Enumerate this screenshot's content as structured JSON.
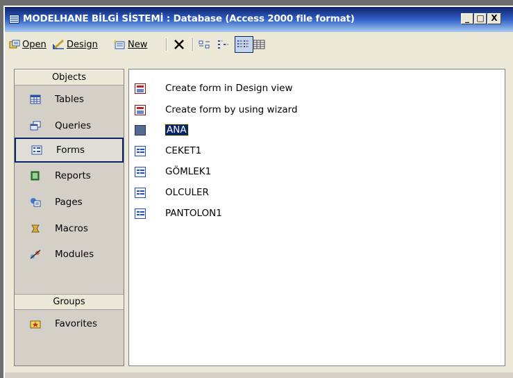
{
  "window": {
    "title": "MODELHANE BİLGİ SİSTEMİ : Database (Access 2000 file format)",
    "buttons": {
      "minimize": "_",
      "maximize": "□",
      "close": "X"
    }
  },
  "toolbar": {
    "open_label": "Open",
    "design_label": "Design",
    "new_label": "New",
    "delete_icon": "delete-icon"
  },
  "sidebar": {
    "objects_header": "Objects",
    "groups_header": "Groups",
    "items": [
      {
        "label": "Tables",
        "icon": "table-icon"
      },
      {
        "label": "Queries",
        "icon": "query-icon"
      },
      {
        "label": "Forms",
        "icon": "form-icon",
        "selected": true
      },
      {
        "label": "Reports",
        "icon": "report-icon"
      },
      {
        "label": "Pages",
        "icon": "page-icon"
      },
      {
        "label": "Macros",
        "icon": "macro-icon"
      },
      {
        "label": "Modules",
        "icon": "module-icon"
      }
    ],
    "groups": [
      {
        "label": "Favorites",
        "icon": "favorites-icon"
      }
    ]
  },
  "objects_list": {
    "items": [
      {
        "label": "Create form in Design view",
        "icon": "design-wizard-icon"
      },
      {
        "label": "Create form by using wizard",
        "icon": "form-wizard-icon"
      },
      {
        "label": "ANA",
        "icon": "form-icon",
        "selected": true
      },
      {
        "label": "CEKET1",
        "icon": "form-icon"
      },
      {
        "label": "GÖMLEK1",
        "icon": "form-icon"
      },
      {
        "label": "OLCULER",
        "icon": "form-icon"
      },
      {
        "label": "PANTOLON1",
        "icon": "form-icon"
      }
    ]
  },
  "colors": {
    "titlebar_start": "#10246a",
    "titlebar_end": "#a6caf0",
    "selection": "#0a246a",
    "window_bg": "#ece9d8"
  }
}
